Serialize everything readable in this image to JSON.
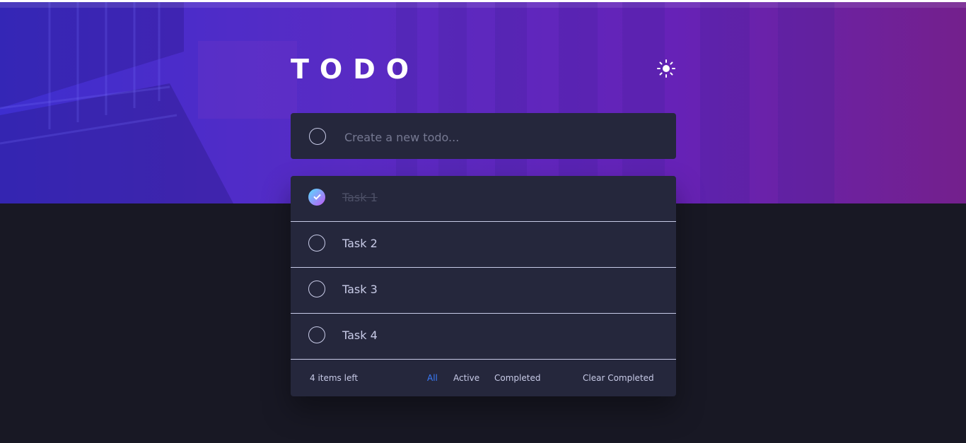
{
  "header": {
    "title": "TODO"
  },
  "new_todo": {
    "placeholder": "Create a new todo..."
  },
  "todos": [
    {
      "label": "Task 1",
      "completed": true
    },
    {
      "label": "Task 2",
      "completed": false
    },
    {
      "label": "Task 3",
      "completed": false
    },
    {
      "label": "Task 4",
      "completed": false
    }
  ],
  "footer": {
    "items_left": "4 items left",
    "filters": [
      "All",
      "Active",
      "Completed"
    ],
    "active_filter": "All",
    "clear_label": "Clear Completed"
  },
  "icons": {
    "theme_toggle": "sun-icon",
    "check": "check-icon"
  },
  "colors": {
    "accent": "#3a7cfd",
    "card": "#25273c",
    "background": "#181824",
    "text": "#c8cbe7",
    "completed_text": "#4d5067",
    "check_gradient_start": "#57ddff",
    "check_gradient_end": "#c058f3"
  }
}
